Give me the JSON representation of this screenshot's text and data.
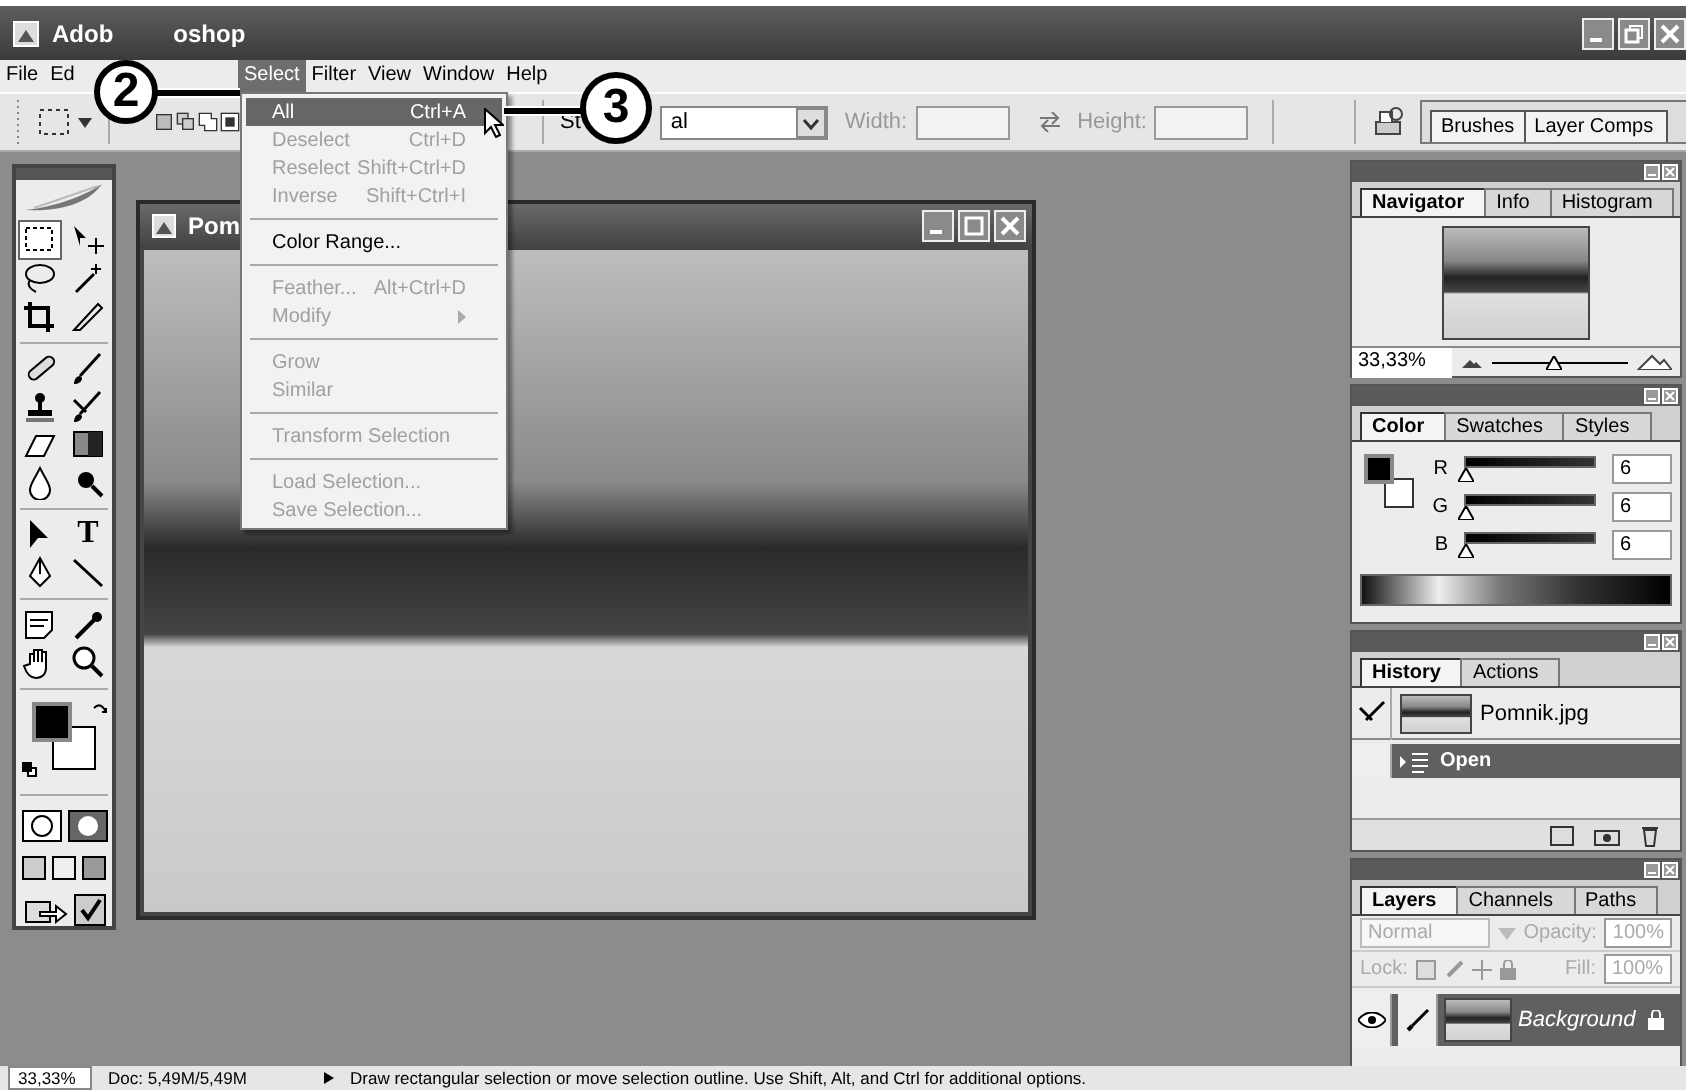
{
  "window": {
    "title_parts": [
      "Adob",
      "oshop"
    ]
  },
  "menubar": {
    "leading": [
      {
        "label": "File",
        "selected": false
      },
      {
        "label": "Ed",
        "selected": false
      }
    ],
    "trailing": [
      {
        "label": "Select",
        "selected": true
      },
      {
        "label": "Filter",
        "selected": false
      },
      {
        "label": "View",
        "selected": false
      },
      {
        "label": "Window",
        "selected": false
      },
      {
        "label": "Help",
        "selected": false
      }
    ]
  },
  "options_bar": {
    "style_label": "St",
    "style_value": "al",
    "width_label": "Width:",
    "height_label": "Height:",
    "size_disabled": true,
    "well_tabs": [
      "Brushes",
      "Layer Comps"
    ]
  },
  "toolbox": {
    "type_glyph": "T"
  },
  "select_menu": {
    "items": [
      {
        "kind": "item",
        "label": "All",
        "shortcut": "Ctrl+A",
        "selected": true,
        "disabled": false
      },
      {
        "kind": "item",
        "label": "Deselect",
        "shortcut": "Ctrl+D",
        "selected": false,
        "disabled": true
      },
      {
        "kind": "item",
        "label": "Reselect",
        "shortcut": "Shift+Ctrl+D",
        "selected": false,
        "disabled": true
      },
      {
        "kind": "item",
        "label": "Inverse",
        "shortcut": "Shift+Ctrl+I",
        "selected": false,
        "disabled": true
      },
      {
        "kind": "separator"
      },
      {
        "kind": "item",
        "label": "Color Range...",
        "selected": false,
        "disabled": false
      },
      {
        "kind": "separator"
      },
      {
        "kind": "item",
        "label": "Feather...",
        "shortcut": "Alt+Ctrl+D",
        "selected": false,
        "disabled": true
      },
      {
        "kind": "submenu",
        "label": "Modify",
        "selected": false,
        "disabled": true
      },
      {
        "kind": "separator"
      },
      {
        "kind": "item",
        "label": "Grow",
        "selected": false,
        "disabled": true
      },
      {
        "kind": "item",
        "label": "Similar",
        "selected": false,
        "disabled": true
      },
      {
        "kind": "separator"
      },
      {
        "kind": "item",
        "label": "Transform Selection",
        "selected": false,
        "disabled": true
      },
      {
        "kind": "separator"
      },
      {
        "kind": "item",
        "label": "Load Selection...",
        "selected": false,
        "disabled": true
      },
      {
        "kind": "item",
        "label": "Save Selection...",
        "selected": false,
        "disabled": true
      }
    ]
  },
  "callouts": [
    {
      "label": "2"
    },
    {
      "label": "3"
    }
  ],
  "document": {
    "title": "Pom"
  },
  "navigator": {
    "tabs": [
      {
        "label": "Navigator",
        "selected": true
      },
      {
        "label": "Info",
        "selected": false
      },
      {
        "label": "Histogram",
        "selected": false
      }
    ],
    "zoom": "33,33%",
    "level": 0.45
  },
  "color_panel": {
    "tabs": [
      {
        "label": "Color",
        "selected": true
      },
      {
        "label": "Swatches",
        "selected": false
      },
      {
        "label": "Styles",
        "selected": false
      }
    ],
    "channels": [
      {
        "name": "R",
        "value": "6",
        "level": 0.02
      },
      {
        "name": "G",
        "value": "6",
        "level": 0.02
      },
      {
        "name": "B",
        "value": "6",
        "level": 0.02
      }
    ]
  },
  "history": {
    "tabs": [
      {
        "label": "History",
        "selected": true
      },
      {
        "label": "Actions",
        "selected": false
      }
    ],
    "snapshot": "Pomnik.jpg",
    "steps": [
      {
        "name": "Open",
        "selected": true
      }
    ]
  },
  "layers": {
    "tabs": [
      {
        "label": "Layers",
        "selected": true
      },
      {
        "label": "Channels",
        "selected": false
      },
      {
        "label": "Paths",
        "selected": false
      }
    ],
    "blend_mode": "Normal",
    "opacity_label": "Opacity:",
    "opacity": "100%",
    "lock_label": "Lock:",
    "fill_label": "Fill:",
    "fill": "100%",
    "controls_disabled": true,
    "items": [
      {
        "name": "Background",
        "selected": true,
        "visible": true,
        "locked": true
      }
    ]
  },
  "status_bar": {
    "zoom": "33,33%",
    "doc": "Doc: 5,49M/5,49M",
    "hint": "Draw rectangular selection or move selection outline. Use Shift, Alt, and Ctrl for additional options."
  }
}
